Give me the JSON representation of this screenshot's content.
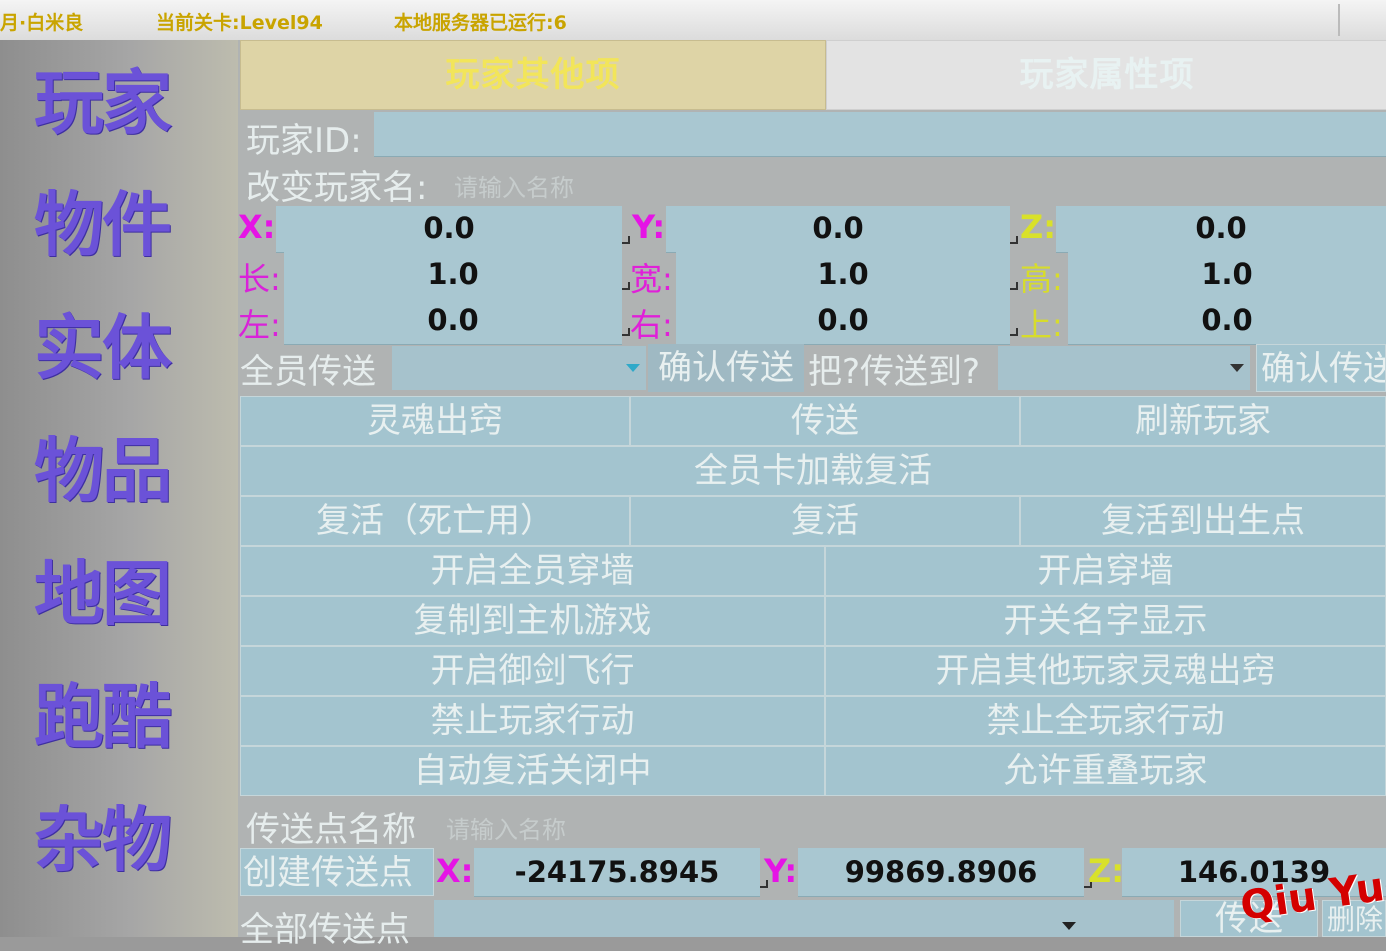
{
  "status_bar": {
    "player": "月·白米良",
    "level": "当前关卡:Level94",
    "server": "本地服务器已运行:6"
  },
  "sidebar": {
    "items": [
      "玩家",
      "物件",
      "实体",
      "物品",
      "地图",
      "跑酷",
      "杂物"
    ]
  },
  "tabs": {
    "active": "玩家其他项",
    "inactive": "玩家属性项"
  },
  "player": {
    "id_label": "玩家ID:",
    "rename_label": "改变玩家名:",
    "rename_placeholder": "请输入名称"
  },
  "coords": {
    "x_label": "X:",
    "y_label": "Y:",
    "z_label": "Z:",
    "x": "0.0",
    "y": "0.0",
    "z": "0.0",
    "len_label": "长:",
    "wid_label": "宽:",
    "hei_label": "高:",
    "len": "1.0",
    "wid": "1.0",
    "hei": "1.0",
    "left_label": "左:",
    "right_label": "右:",
    "up_label": "上:",
    "left": "0.0",
    "right": "0.0",
    "up": "0.0"
  },
  "teleport_row": {
    "all_label": "全员传送",
    "confirm1": "确认传送",
    "who_label": "把?传送到?",
    "confirm2": "确认传送"
  },
  "buttons": {
    "soul_out": "灵魂出窍",
    "teleport": "传送",
    "refresh": "刷新玩家",
    "all_load_revive": "全员卡加载复活",
    "revive_dead": "复活（死亡用）",
    "revive": "复活",
    "revive_spawn": "复活到出生点",
    "all_noclip": "开启全员穿墙",
    "noclip": "开启穿墙",
    "copy_host": "复制到主机游戏",
    "toggle_names": "开关名字显示",
    "sword_fly": "开启御剑飞行",
    "others_soul": "开启其他玩家灵魂出窍",
    "ban_player": "禁止玩家行动",
    "ban_all": "禁止全玩家行动",
    "auto_revive": "自动复活关闭中",
    "allow_overlap": "允许重叠玩家"
  },
  "teleport_point": {
    "name_label": "传送点名称",
    "name_placeholder": "请输入名称",
    "create": "创建传送点",
    "x_label": "X:",
    "y_label": "Y:",
    "z_label": "Z:",
    "x": "-24175.8945",
    "y": "99869.8906",
    "z": "146.0139",
    "all_points": "全部传送点",
    "go": "传送",
    "delete": "删除"
  },
  "watermark": "Qiu Yue",
  "icons": {
    "dropdown": "triangle-down-icon",
    "resize": "resize-corner-icon"
  }
}
